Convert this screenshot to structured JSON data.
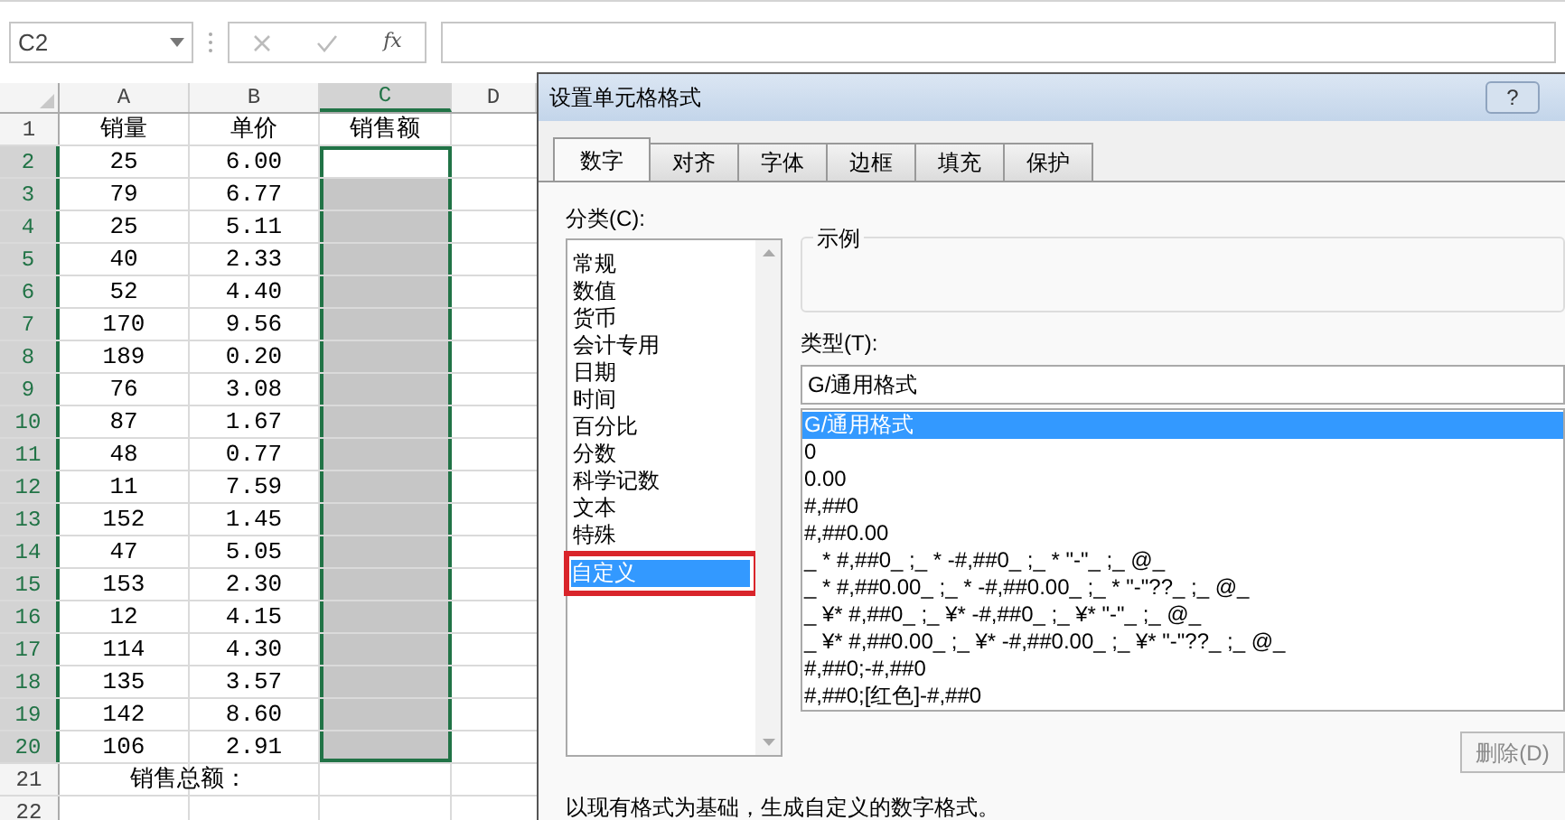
{
  "formula_bar": {
    "name_box": "C2",
    "function_label": "fx"
  },
  "sheet": {
    "columns": [
      {
        "label": "A",
        "selected": false
      },
      {
        "label": "B",
        "selected": false
      },
      {
        "label": "C",
        "selected": true
      },
      {
        "label": "D",
        "selected": false
      }
    ],
    "rows": [
      {
        "number": "1",
        "selected": false,
        "cells": [
          "销量",
          "单价",
          "销售额"
        ]
      },
      {
        "number": "2",
        "selected": true,
        "cells": [
          "25",
          "6.00",
          ""
        ]
      },
      {
        "number": "3",
        "selected": true,
        "cells": [
          "79",
          "6.77",
          ""
        ]
      },
      {
        "number": "4",
        "selected": true,
        "cells": [
          "25",
          "5.11",
          ""
        ]
      },
      {
        "number": "5",
        "selected": true,
        "cells": [
          "40",
          "2.33",
          ""
        ]
      },
      {
        "number": "6",
        "selected": true,
        "cells": [
          "52",
          "4.40",
          ""
        ]
      },
      {
        "number": "7",
        "selected": true,
        "cells": [
          "170",
          "9.56",
          ""
        ]
      },
      {
        "number": "8",
        "selected": true,
        "cells": [
          "189",
          "0.20",
          ""
        ]
      },
      {
        "number": "9",
        "selected": true,
        "cells": [
          "76",
          "3.08",
          ""
        ]
      },
      {
        "number": "10",
        "selected": true,
        "cells": [
          "87",
          "1.67",
          ""
        ]
      },
      {
        "number": "11",
        "selected": true,
        "cells": [
          "48",
          "0.77",
          ""
        ]
      },
      {
        "number": "12",
        "selected": true,
        "cells": [
          "11",
          "7.59",
          ""
        ]
      },
      {
        "number": "13",
        "selected": true,
        "cells": [
          "152",
          "1.45",
          ""
        ]
      },
      {
        "number": "14",
        "selected": true,
        "cells": [
          "47",
          "5.05",
          ""
        ]
      },
      {
        "number": "15",
        "selected": true,
        "cells": [
          "153",
          "2.30",
          ""
        ]
      },
      {
        "number": "16",
        "selected": true,
        "cells": [
          "12",
          "4.15",
          ""
        ]
      },
      {
        "number": "17",
        "selected": true,
        "cells": [
          "114",
          "4.30",
          ""
        ]
      },
      {
        "number": "18",
        "selected": true,
        "cells": [
          "135",
          "3.57",
          ""
        ]
      },
      {
        "number": "19",
        "selected": true,
        "cells": [
          "142",
          "8.60",
          ""
        ]
      },
      {
        "number": "20",
        "selected": true,
        "cells": [
          "106",
          "2.91",
          ""
        ]
      },
      {
        "number": "21",
        "selected": false,
        "cells": [
          "销售总额：",
          "",
          ""
        ]
      },
      {
        "number": "22",
        "selected": false,
        "cells": [
          "",
          "",
          ""
        ]
      }
    ]
  },
  "dialog": {
    "title": "设置单元格格式",
    "help": "?",
    "tabs": [
      {
        "label": "数字",
        "selected": true
      },
      {
        "label": "对齐",
        "selected": false
      },
      {
        "label": "字体",
        "selected": false
      },
      {
        "label": "边框",
        "selected": false
      },
      {
        "label": "填充",
        "selected": false
      },
      {
        "label": "保护",
        "selected": false
      }
    ],
    "category_label": "分类(C):",
    "categories": [
      {
        "label": "常规",
        "selected": false,
        "highlighted": false
      },
      {
        "label": "数值",
        "selected": false,
        "highlighted": false
      },
      {
        "label": "货币",
        "selected": false,
        "highlighted": false
      },
      {
        "label": "会计专用",
        "selected": false,
        "highlighted": false
      },
      {
        "label": "日期",
        "selected": false,
        "highlighted": false
      },
      {
        "label": "时间",
        "selected": false,
        "highlighted": false
      },
      {
        "label": "百分比",
        "selected": false,
        "highlighted": false
      },
      {
        "label": "分数",
        "selected": false,
        "highlighted": false
      },
      {
        "label": "科学记数",
        "selected": false,
        "highlighted": false
      },
      {
        "label": "文本",
        "selected": false,
        "highlighted": false
      },
      {
        "label": "特殊",
        "selected": false,
        "highlighted": false
      },
      {
        "label": "自定义",
        "selected": true,
        "highlighted": true
      }
    ],
    "sample_label": "示例",
    "type_label": "类型(T):",
    "type_value": "G/通用格式",
    "types": [
      {
        "label": "G/通用格式",
        "selected": true
      },
      {
        "label": "0",
        "selected": false
      },
      {
        "label": "0.00",
        "selected": false
      },
      {
        "label": "#,##0",
        "selected": false
      },
      {
        "label": "#,##0.00",
        "selected": false
      },
      {
        "label": "_ * #,##0_ ;_ * -#,##0_ ;_ * \"-\"_ ;_ @_",
        "selected": false
      },
      {
        "label": "_ * #,##0.00_ ;_ * -#,##0.00_ ;_ * \"-\"??_ ;_ @_",
        "selected": false
      },
      {
        "label": "_ ¥* #,##0_ ;_ ¥* -#,##0_ ;_ ¥* \"-\"_ ;_ @_",
        "selected": false
      },
      {
        "label": "_ ¥* #,##0.00_ ;_ ¥* -#,##0.00_ ;_ ¥* \"-\"??_ ;_ @_",
        "selected": false
      },
      {
        "label": "#,##0;-#,##0",
        "selected": false
      },
      {
        "label": "#,##0;[红色]-#,##0",
        "selected": false
      }
    ],
    "delete_button": "删除(D)",
    "description": "以现有格式为基础，生成自定义的数字格式。"
  }
}
